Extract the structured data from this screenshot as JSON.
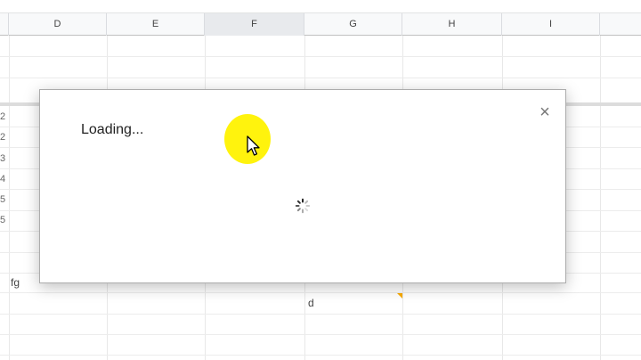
{
  "columns": [
    "D",
    "E",
    "F",
    "G",
    "H",
    "I"
  ],
  "selected_column": "F",
  "row_numbers": [
    "2",
    "2",
    "3",
    "4",
    "5",
    "5"
  ],
  "cells": {
    "fg": "fg",
    "d": "d"
  },
  "dialog": {
    "title": "Loading...",
    "close_symbol": "×"
  },
  "colors": {
    "highlight": "#fff200",
    "note_marker": "#f9ab00"
  }
}
